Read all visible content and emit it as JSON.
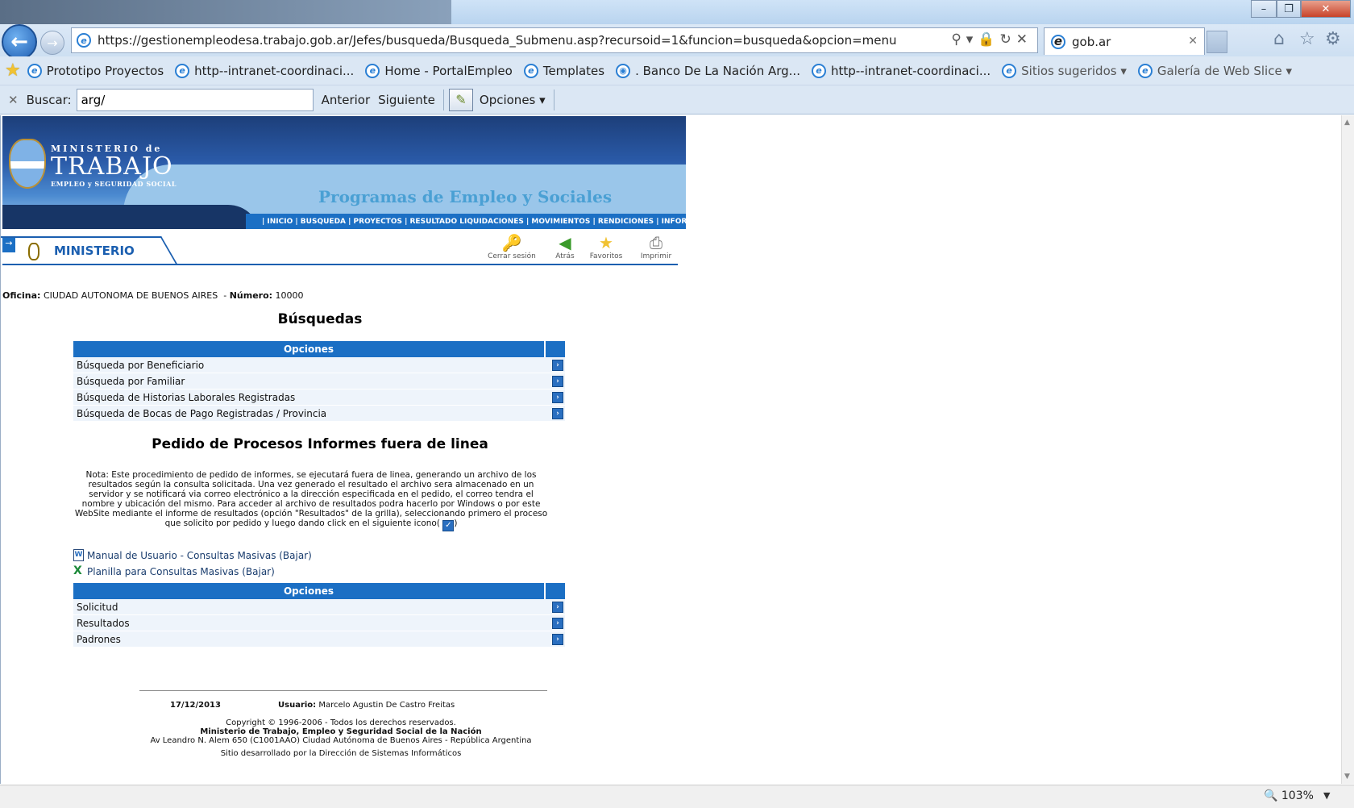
{
  "browser": {
    "address_url": "https://gestionempleodesa.trabajo.gob.ar/Jefes/busqueda/Busqueda_Submenu.asp?recursoid=1&funcion=busqueda&opcion=menu",
    "tab_title": "gob.ar",
    "favorites": [
      "Prototipo Proyectos",
      "http--intranet-coordinaci...",
      "Home - PortalEmpleo",
      "Templates",
      ". Banco De La Nación Arg...",
      "http--intranet-coordinaci...",
      "Sitios sugeridos",
      "Galería de Web Slice"
    ],
    "find": {
      "label": "Buscar:",
      "value": "arg/",
      "prev": "Anterior",
      "next": "Siguiente",
      "options": "Opciones"
    },
    "zoom": "103%"
  },
  "header": {
    "ministry_small": "MINISTERIO de",
    "ministry_big": "TRABAJO",
    "ministry_sub": "EMPLEO y SEGURIDAD SOCIAL",
    "program_title": "Programas de Empleo y Sociales",
    "nav": "| INICIO | BUSQUEDA | PROYECTOS | RESULTADO LIQUIDACIONES | MOVIMIENTOS | RENDICIONES | INFORMACION",
    "section_label": "MINISTERIO",
    "tools": [
      "Cerrar sesión",
      "Atrás",
      "Favoritos",
      "Imprimir"
    ]
  },
  "oficina": {
    "label": "Oficina:",
    "value": "CIUDAD AUTONOMA DE BUENOS AIRES",
    "numero_label": "Número:",
    "numero": "10000"
  },
  "busquedas": {
    "title": "Búsquedas",
    "header": "Opciones",
    "rows": [
      "Búsqueda por Beneficiario",
      "Búsqueda por Familiar",
      "Búsqueda de Historias Laborales Registradas",
      "Búsqueda de Bocas de Pago Registradas / Provincia"
    ]
  },
  "pedido": {
    "title": "Pedido de Procesos Informes fuera de linea",
    "nota": "Nota: Este procedimiento de pedido de informes, se ejecutará fuera de linea, generando un archivo de los resultados según la consulta solicitada. Una vez generado el resultado el archivo sera almacenado en un servidor y se notificará via correo electrónico a la dirección especificada en el pedido, el correo tendra el nombre y ubicación del mismo. Para acceder al archivo de resultados podra hacerlo por Windows o por este WebSite mediante el informe de resultados (opción \"Resultados\" de la grilla), seleccionando primero el proceso que solicito por pedido y luego dando click en el siguiente icono(",
    "nota_end": ")",
    "manual": "Manual de Usuario - Consultas Masivas (Bajar)",
    "planilla": "Planilla para Consultas Masivas (Bajar)",
    "header": "Opciones",
    "rows": [
      "Solicitud",
      "Resultados",
      "Padrones"
    ]
  },
  "footer": {
    "date": "17/12/2013",
    "user_label": "Usuario:",
    "user": "Marcelo Agustin De Castro Freitas",
    "copyright": "Copyright © 1996-2006 - Todos los derechos reservados.",
    "org": "Ministerio de Trabajo, Empleo y Seguridad Social de la Nación",
    "address": "Av Leandro N. Alem 650 (C1001AAO) Ciudad Autónoma de Buenos Aires - República Argentina",
    "dev": "Sitio desarrollado por la Dirección de Sistemas Informáticos"
  }
}
